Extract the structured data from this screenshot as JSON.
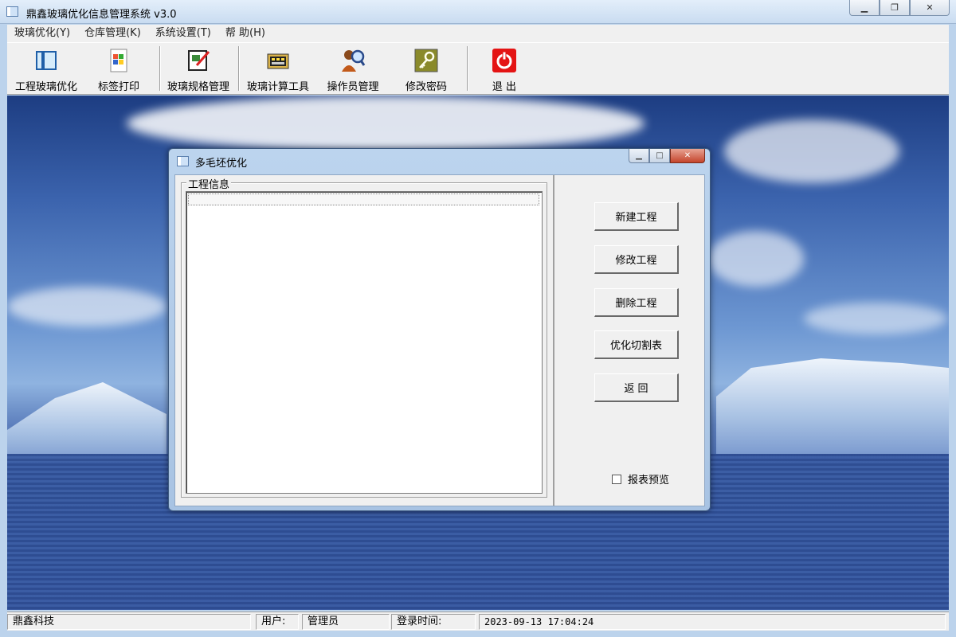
{
  "window": {
    "title": "鼎鑫玻璃优化信息管理系统 v3.0"
  },
  "menu": [
    {
      "label": "玻璃优化(Y)"
    },
    {
      "label": "仓库管理(K)"
    },
    {
      "label": "系统设置(T)"
    },
    {
      "label": "帮 助(H)"
    }
  ],
  "toolbar": [
    {
      "label": "工程玻璃优化",
      "icon": "book-icon"
    },
    {
      "label": "标签打印",
      "icon": "label-print-icon"
    },
    {
      "label": "玻璃规格管理",
      "icon": "spec-edit-icon"
    },
    {
      "label": "玻璃计算工具",
      "icon": "calculator-icon"
    },
    {
      "label": "操作员管理",
      "icon": "user-search-icon"
    },
    {
      "label": "修改密码",
      "icon": "key-icon"
    },
    {
      "label": "退 出",
      "icon": "power-icon"
    }
  ],
  "dialog": {
    "title": "多毛坯优化",
    "group_label": "工程信息",
    "buttons": [
      {
        "label": "新建工程"
      },
      {
        "label": "修改工程"
      },
      {
        "label": "删除工程"
      },
      {
        "label": "优化切割表"
      },
      {
        "label": "返 回"
      }
    ],
    "checkbox": {
      "label": "报表预览",
      "checked": false
    }
  },
  "status": {
    "company": "鼎鑫科技",
    "user_label": "用户:",
    "user_value": "管理员",
    "login_label": "登录时间:",
    "login_time": "2023-09-13  17:04:24"
  },
  "colors": {
    "close_red": "#c4452c",
    "exit_red": "#e41414",
    "dialog_frame": "#bcd4ee"
  }
}
